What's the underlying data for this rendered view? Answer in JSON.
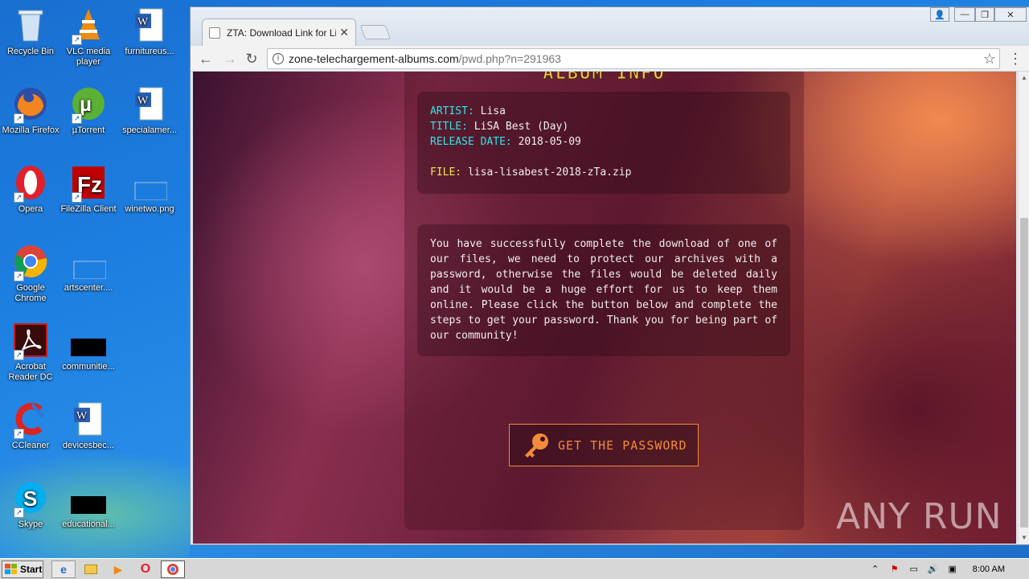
{
  "desktop": {
    "icons": [
      {
        "label": "Recycle Bin"
      },
      {
        "label": "VLC media player"
      },
      {
        "label": "furnitureus..."
      },
      {
        "label": "Mozilla Firefox"
      },
      {
        "label": "µTorrent"
      },
      {
        "label": "specialamer..."
      },
      {
        "label": "Opera"
      },
      {
        "label": "FileZilla Client"
      },
      {
        "label": "winetwo.png"
      },
      {
        "label": "Google Chrome"
      },
      {
        "label": "artscenter...."
      },
      {
        "label": "Acrobat Reader DC"
      },
      {
        "label": "communitie..."
      },
      {
        "label": "CCleaner"
      },
      {
        "label": "devicesbec..."
      },
      {
        "label": "Skype"
      },
      {
        "label": "educational..."
      }
    ]
  },
  "browser": {
    "tab_title": "ZTA: Download Link for Lisa",
    "url_host": "zone-telechargement-albums.com",
    "url_path": "/pwd.php?n=291963"
  },
  "page": {
    "album_heading": "ALBUM INFO",
    "artist_label": "ARTIST:",
    "artist_value": "Lisa",
    "title_label": "TITLE:",
    "title_value": "LiSA Best (Day)",
    "release_label": "RELEASE DATE:",
    "release_value": "2018-05-09",
    "file_label": "FILE:",
    "file_value": "lisa-lisabest-2018-zTa.zip",
    "message": "You have successfully complete the download of one of our files, we need to protect our archives with a password, otherwise the files would be deleted daily and it would be a huge effort for us to keep them online. Please click the button below and complete the steps to get your password. Thank you for being part of our community!",
    "button_label": "GET THE PASSWORD",
    "watermark": "ANY RUN"
  },
  "taskbar": {
    "start_label": "Start",
    "clock": "8:00 AM"
  },
  "colors": {
    "key_cyan": "#2ee6e6",
    "key_yellow": "#f4e24a",
    "button_orange": "#f28b3a",
    "heading_gold": "#f3c64a"
  }
}
